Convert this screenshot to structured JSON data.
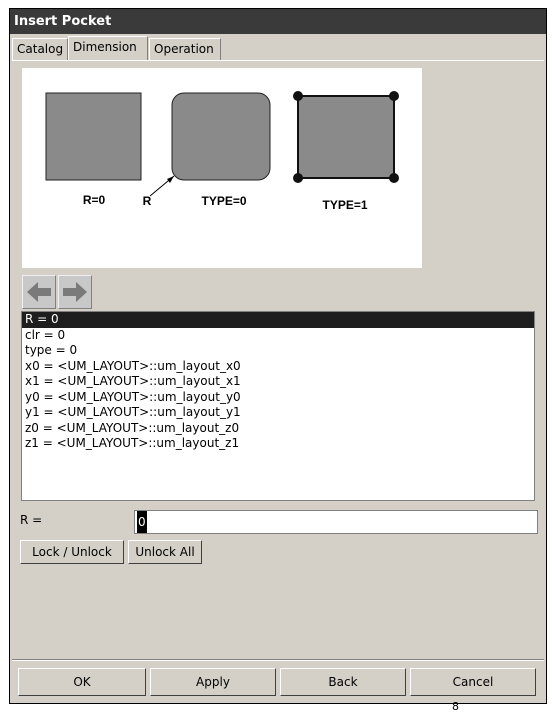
{
  "window": {
    "title": "Insert Pocket"
  },
  "tabs": [
    {
      "label": "Catalog",
      "active": false
    },
    {
      "label": "Dimension",
      "active": true
    },
    {
      "label": "Operation",
      "active": false
    }
  ],
  "preview": {
    "labels": {
      "r0": "R=0",
      "r": "R",
      "type0": "TYPE=0",
      "type1": "TYPE=1"
    }
  },
  "nav": {
    "back_icon": "left-arrow-icon",
    "forward_icon": "right-arrow-icon"
  },
  "parameters": [
    "R = 0",
    "clr = 0",
    "type = 0",
    "x0 = <UM_LAYOUT>::um_layout_x0",
    "x1 = <UM_LAYOUT>::um_layout_x1",
    "y0 = <UM_LAYOUT>::um_layout_y0",
    "y1 = <UM_LAYOUT>::um_layout_y1",
    "z0 = <UM_LAYOUT>::um_layout_z0",
    "z1 = <UM_LAYOUT>::um_layout_z1"
  ],
  "selected_index": 0,
  "edit": {
    "label": "R =",
    "value": "0"
  },
  "buttons": {
    "lock_unlock": "Lock / Unlock",
    "unlock_all": "Unlock All"
  },
  "footer": {
    "ok": "OK",
    "apply": "Apply",
    "back": "Back",
    "cancel": "Cancel"
  },
  "page_number": "8"
}
